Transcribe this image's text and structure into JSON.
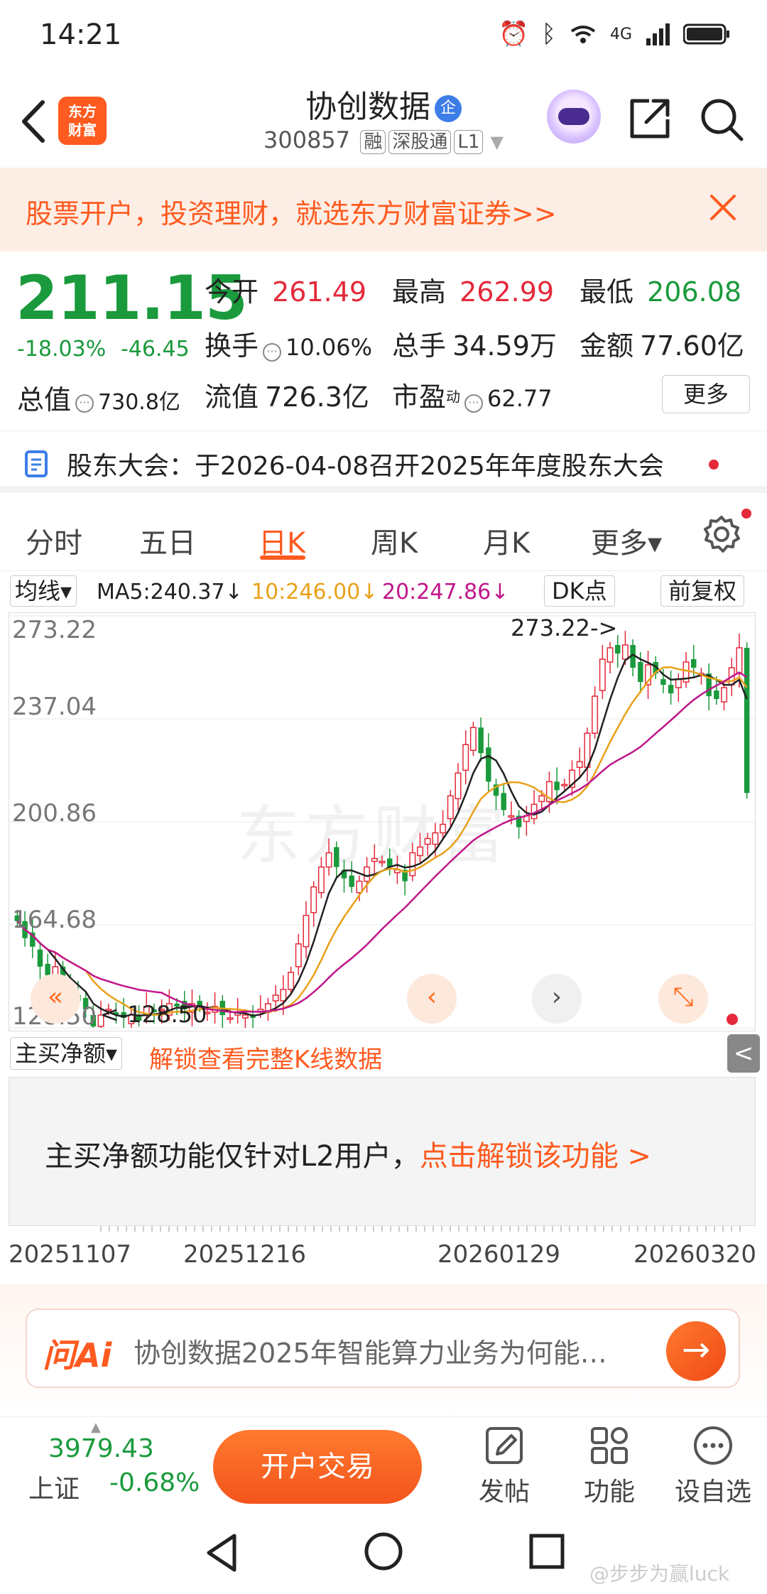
{
  "status_bar": {
    "time": "14:21",
    "network": "4G"
  },
  "header": {
    "back_label": "<",
    "logo_line1": "东方",
    "logo_line2": "财富",
    "stock_name": "协创数据",
    "verified_badge": "企",
    "stock_code": "300857",
    "tags": [
      "融",
      "深股通",
      "L1"
    ]
  },
  "banner": {
    "text": "股票开户，投资理财，就选东方财富证券>>"
  },
  "quote": {
    "price": "211.15",
    "change_pct": "-18.03%",
    "change_amt": "-46.45",
    "open_label": "今开",
    "open": "261.49",
    "high_label": "最高",
    "high": "262.99",
    "low_label": "最低",
    "low": "206.08",
    "turnover_label": "换手",
    "turnover": "10.06%",
    "volume_label": "总手",
    "volume": "34.59万",
    "amount_label": "金额",
    "amount": "77.60亿",
    "total_value_label": "总值",
    "total_value": "730.8亿",
    "float_value_label": "流值",
    "float_value": "726.3亿",
    "pe_label": "市盈",
    "pe_sup": "动",
    "pe": "62.77",
    "more_label": "更多"
  },
  "notice": {
    "text": "股东大会：于2026-04-08召开2025年年度股东大会"
  },
  "tabs": [
    "分时",
    "五日",
    "日K",
    "周K",
    "月K",
    "更多▾"
  ],
  "active_tab": 2,
  "ma_row": {
    "select": "均线▾",
    "ma5": "MA5:240.37↓",
    "ma10": "10:246.00↓",
    "ma20": "20:247.86↓",
    "dk": "DK点",
    "adjust": "前复权"
  },
  "chart_data": {
    "type": "candlestick",
    "y_ticks": [
      "273.22",
      "237.04",
      "200.86",
      "164.68",
      "128.50"
    ],
    "ylim": [
      128.5,
      273.22
    ],
    "max_label": "273.22->",
    "min_label": "<-128.50",
    "watermark": "东方财富",
    "colors": {
      "up": "#e4293a",
      "down": "#1a9a3c",
      "ma5": "#222222",
      "ma10": "#e8a11a",
      "ma20": "#c0168a"
    },
    "close": [
      166,
      160,
      157,
      150,
      147,
      150,
      142,
      141,
      138,
      135,
      129,
      133,
      135,
      133,
      132,
      133,
      131,
      136,
      134,
      135,
      137,
      136,
      135,
      137,
      136,
      134,
      136,
      133,
      132,
      134,
      133,
      132,
      135,
      137,
      140,
      142,
      148,
      158,
      168,
      178,
      185,
      190,
      185,
      181,
      178,
      180,
      185,
      188,
      187,
      185,
      184,
      180,
      190,
      192,
      195,
      197,
      200,
      210,
      218,
      228,
      234,
      225,
      215,
      210,
      205,
      203,
      199,
      203,
      207,
      210,
      215,
      212,
      214,
      219,
      222,
      232,
      245,
      258,
      262,
      260,
      263,
      255,
      250,
      256,
      253,
      249,
      246,
      251,
      257,
      255,
      253,
      245,
      244,
      248,
      255,
      262,
      211
    ]
  },
  "chart_nav": {
    "first": "«",
    "prev": "‹",
    "next": "›",
    "fullscreen": "⤡"
  },
  "indicator": {
    "select": "主买净额▾",
    "unlock": "解锁查看完整K线数据",
    "collapse": "<",
    "message": "主买净额功能仅针对L2用户，",
    "link": "点击解锁该功能 >"
  },
  "date_axis": [
    "20251107",
    "20251216",
    "20260129",
    "20260320"
  ],
  "ai": {
    "logo": "问Ai",
    "query": "协创数据2025年智能算力业务为何能…",
    "go": "→"
  },
  "toolbar": {
    "index_value": "3979.43",
    "index_name": "上证",
    "index_change": "-0.68%",
    "trade_button": "开户交易",
    "post": "发帖",
    "function": "功能",
    "watchlist": "设自选"
  },
  "watermark_user": "@步步为赢luck"
}
